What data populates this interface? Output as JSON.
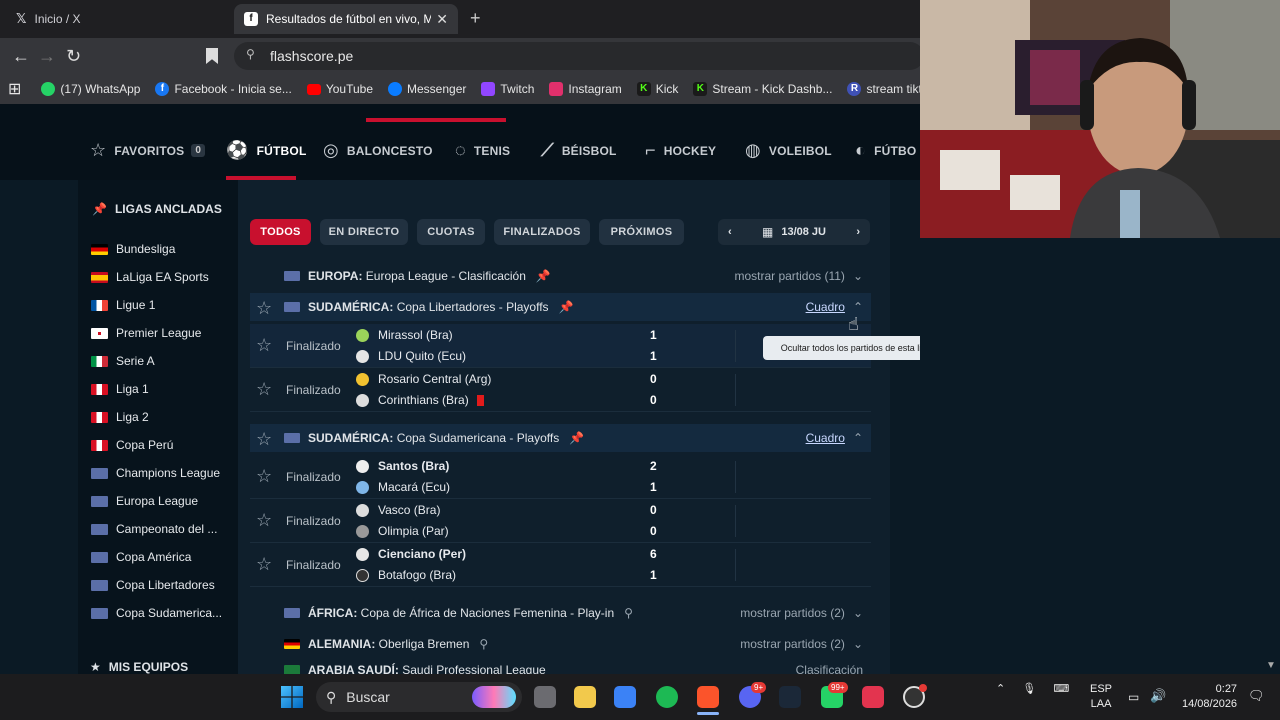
{
  "browser": {
    "tabs": [
      {
        "label": "Inicio / X"
      },
      {
        "label": "Resultados de fútbol en vivo, Ma"
      }
    ],
    "url": "flashscore.pe",
    "bookmarks": [
      {
        "label": "(17) WhatsApp",
        "icon": "whatsapp-icon",
        "color": "#25d366"
      },
      {
        "label": "Facebook - Inicia se...",
        "icon": "facebook-icon",
        "color": "#1877f2"
      },
      {
        "label": "YouTube",
        "icon": "youtube-icon",
        "color": "#ff0000"
      },
      {
        "label": "Messenger",
        "icon": "messenger-icon",
        "color": "#0a7cff"
      },
      {
        "label": "Twitch",
        "icon": "twitch-icon",
        "color": "#9146ff"
      },
      {
        "label": "Instagram",
        "icon": "instagram-icon",
        "color": "#e1306c"
      },
      {
        "label": "Kick",
        "icon": "kick-icon",
        "color": "#53fc18"
      },
      {
        "label": "Stream - Kick Dashb...",
        "icon": "kick-icon",
        "color": "#53fc18"
      },
      {
        "label": "stream tiktok",
        "icon": "r-icon",
        "color": "#3f51b5"
      }
    ]
  },
  "sports_nav": {
    "favorites_label": "FAVORITOS",
    "favorites_count": "0",
    "items": [
      "FÚTBOL",
      "BALONCESTO",
      "TENIS",
      "BÉISBOL",
      "HOCKEY",
      "VOLEIBOL",
      "FÚTBO"
    ]
  },
  "sidebar": {
    "pinned_title": "LIGAS ANCLADAS",
    "leagues": [
      {
        "label": "Bundesliga"
      },
      {
        "label": "LaLiga EA Sports"
      },
      {
        "label": "Ligue 1"
      },
      {
        "label": "Premier League"
      },
      {
        "label": "Serie A"
      },
      {
        "label": "Liga 1"
      },
      {
        "label": "Liga 2"
      },
      {
        "label": "Copa Perú"
      },
      {
        "label": "Champions League"
      },
      {
        "label": "Europa League"
      },
      {
        "label": "Campeonato del ..."
      },
      {
        "label": "Copa América"
      },
      {
        "label": "Copa Libertadores"
      },
      {
        "label": "Copa Sudamerica..."
      }
    ],
    "my_teams_title": "MIS EQUIPOS"
  },
  "filters": [
    "TODOS",
    "EN DIRECTO",
    "CUOTAS",
    "FINALIZADOS",
    "PRÓXIMOS"
  ],
  "date": "13/08 JU",
  "leagues": [
    {
      "country": "EUROPA:",
      "name": "Europa League - Clasificación",
      "right": "mostrar partidos (11)"
    },
    {
      "country": "SUDAMÉRICA:",
      "name": "Copa Libertadores - Playoffs",
      "right": "Cuadro"
    },
    {
      "country": "SUDAMÉRICA:",
      "name": "Copa Sudamericana - Playoffs",
      "right": "Cuadro"
    },
    {
      "country": "ÁFRICA:",
      "name": "Copa de África de Naciones Femenina - Play-in",
      "right": "mostrar partidos (2)"
    },
    {
      "country": "ALEMANIA:",
      "name": "Oberliga Bremen",
      "right": "mostrar partidos (2)"
    },
    {
      "country": "ARABIA SAUDÍ:",
      "name": "Saudi Professional League",
      "right": "Clasificación"
    }
  ],
  "matches": [
    {
      "status": "Finalizado",
      "home": "Mirassol (Bra)",
      "away": "LDU Quito (Ecu)",
      "home_score": "1",
      "away_score": "1"
    },
    {
      "status": "Finalizado",
      "home": "Rosario Central (Arg)",
      "away": "Corinthians (Bra)",
      "home_score": "0",
      "away_score": "0"
    },
    {
      "status": "Finalizado",
      "home": "Santos (Bra)",
      "away": "Macará (Ecu)",
      "home_score": "2",
      "away_score": "1"
    },
    {
      "status": "Finalizado",
      "home": "Vasco (Bra)",
      "away": "Olimpia (Par)",
      "home_score": "0",
      "away_score": "0"
    },
    {
      "status": "Finalizado",
      "home": "Cienciano (Per)",
      "away": "Botafogo (Bra)",
      "home_score": "6",
      "away_score": "1"
    }
  ],
  "tooltip": "Ocultar todos los partidos de esta liga",
  "taskbar": {
    "search_placeholder": "Buscar",
    "lang": "ESP",
    "lang2": "LAA",
    "time": "0:27",
    "date": "14/08/2026",
    "discord_badge": "9+",
    "whatsapp_badge": "99+"
  }
}
